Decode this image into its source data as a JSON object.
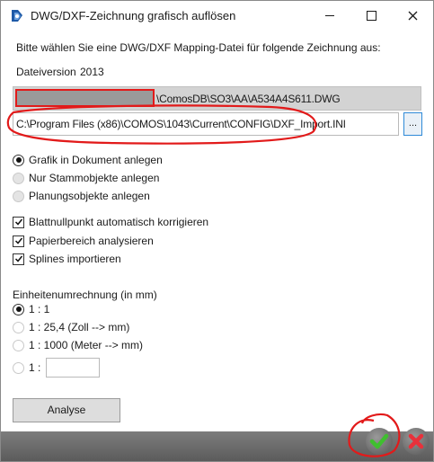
{
  "window": {
    "title": "DWG/DXF-Zeichnung grafisch auflösen",
    "icon": "comos-app-icon"
  },
  "instruction": "Bitte wählen Sie eine DWG/DXF Mapping-Datei für folgende Zeichnung aus:",
  "file_version": {
    "label": "Dateiversion",
    "value": "2013"
  },
  "drawing_path": "\\ComosDB\\SO3\\AA\\A534A4S611.DWG",
  "mapping_path": "C:\\Program Files (x86)\\COMOS\\1043\\Current\\CONFIG\\DXF_Import.INI",
  "browse_label": "...",
  "mode_options": [
    {
      "label": "Grafik in Dokument anlegen",
      "selected": true
    },
    {
      "label": "Nur Stammobjekte anlegen",
      "selected": false
    },
    {
      "label": "Planungsobjekte anlegen",
      "selected": false
    }
  ],
  "checkboxes": [
    {
      "label": "Blattnullpunkt automatisch korrigieren",
      "checked": true
    },
    {
      "label": "Papierbereich analysieren",
      "checked": true
    },
    {
      "label": "Splines importieren",
      "checked": true
    }
  ],
  "units": {
    "heading": "Einheitenumrechnung (in mm)",
    "options": [
      {
        "label": "1 : 1",
        "selected": true
      },
      {
        "label": "1 : 25,4 (Zoll --> mm)",
        "selected": false
      },
      {
        "label": "1 : 1000 (Meter --> mm)",
        "selected": false
      },
      {
        "label": "1 :",
        "selected": false
      }
    ],
    "custom_value": ""
  },
  "analyse_label": "Analyse",
  "actions": {
    "ok_icon": "green-check-icon",
    "cancel_icon": "red-x-icon"
  },
  "colors": {
    "annotation": "#e21a1a",
    "ok_green": "#3fbf2f",
    "cancel_red": "#e8313b",
    "accent_blue": "#2f8ad8"
  }
}
